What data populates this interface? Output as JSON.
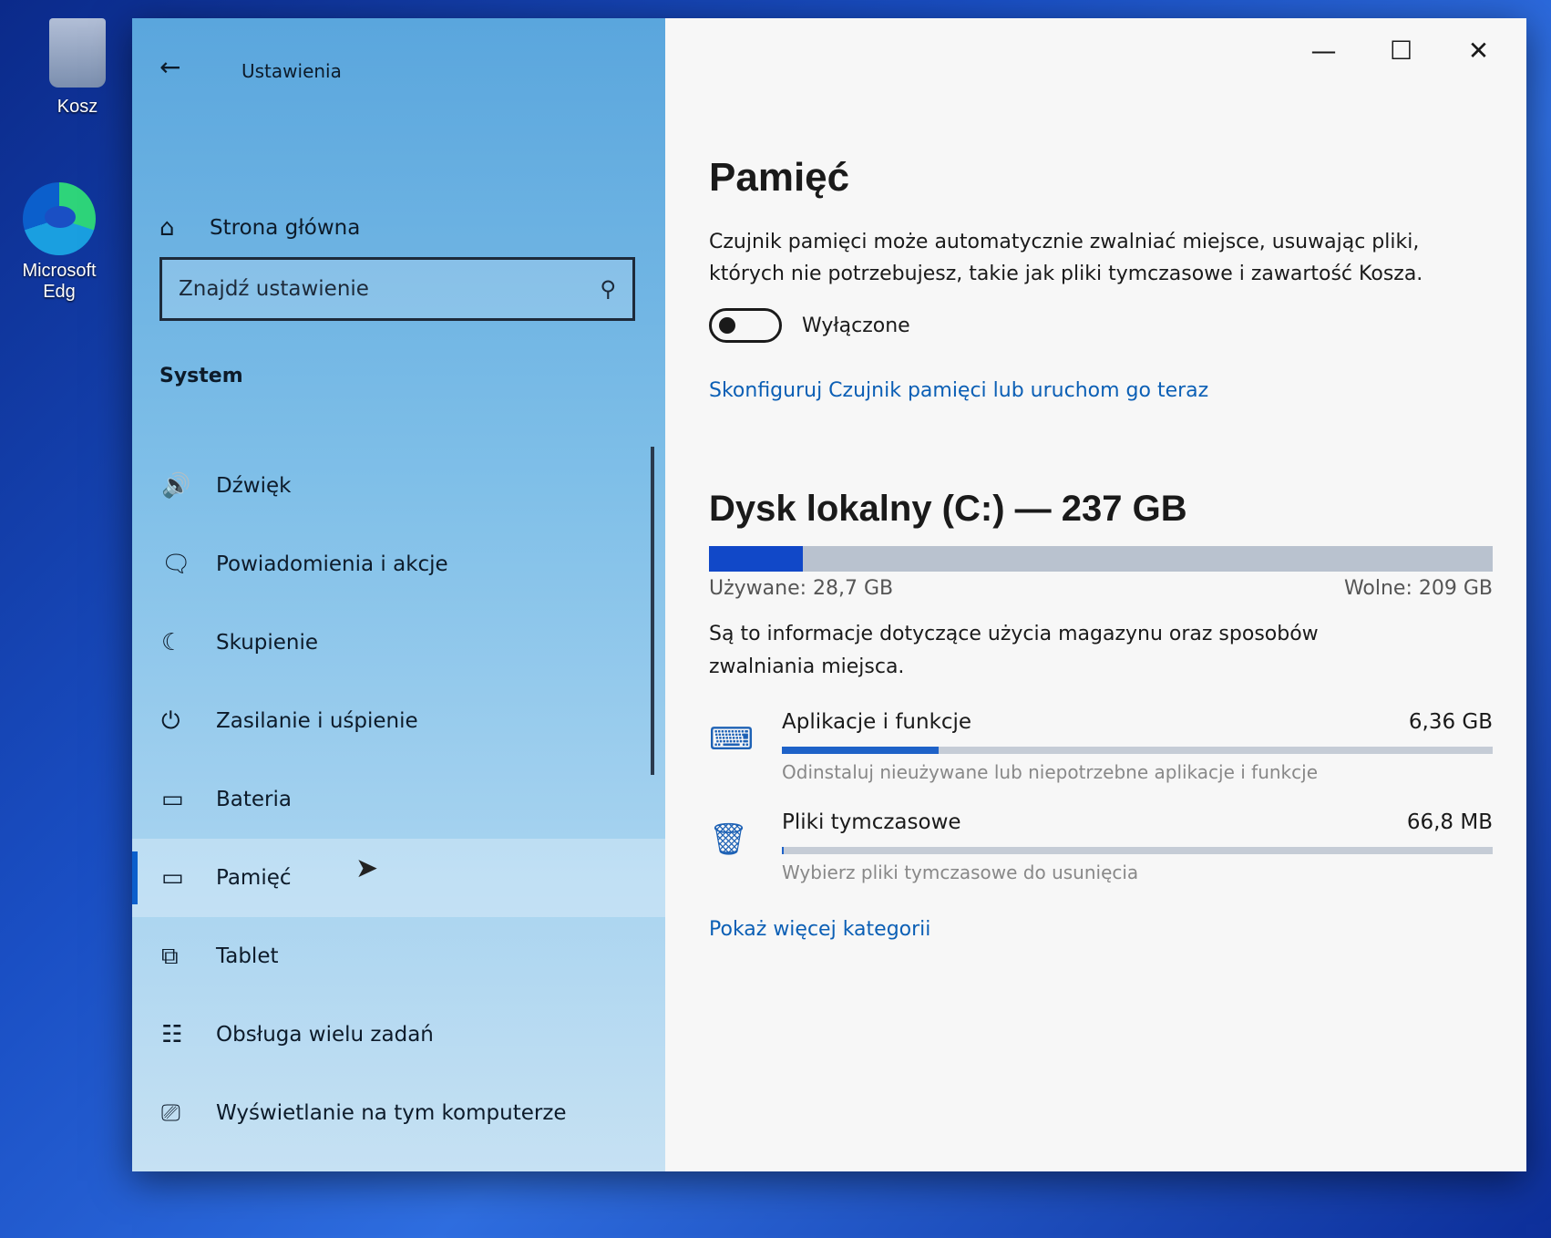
{
  "desktop": {
    "icons": [
      {
        "label": "Kosz"
      },
      {
        "label": "Microsoft Edg"
      }
    ]
  },
  "window": {
    "title": "Ustawienia",
    "controls": {
      "minimize": "—",
      "maximize": "☐",
      "close": "✕"
    }
  },
  "sidebar": {
    "home_label": "Strona główna",
    "search_placeholder": "Znajdź ustawienie",
    "section": "System",
    "items": [
      {
        "label": "Dźwięk",
        "icon": "speaker-icon"
      },
      {
        "label": "Powiadomienia i akcje",
        "icon": "notification-icon"
      },
      {
        "label": "Skupienie",
        "icon": "moon-icon"
      },
      {
        "label": "Zasilanie i uśpienie",
        "icon": "power-icon"
      },
      {
        "label": "Bateria",
        "icon": "battery-icon"
      },
      {
        "label": "Pamięć",
        "icon": "storage-icon",
        "active": true
      },
      {
        "label": "Tablet",
        "icon": "tablet-icon"
      },
      {
        "label": "Obsługa wielu zadań",
        "icon": "multitask-icon"
      },
      {
        "label": "Wyświetlanie na tym komputerze",
        "icon": "project-icon"
      }
    ]
  },
  "main": {
    "title": "Pamięć",
    "description": "Czujnik pamięci może automatycznie zwalniać miejsce, usuwając pliki, których nie potrzebujesz, takie jak pliki tymczasowe i zawartość Kosza.",
    "toggle_label": "Wyłączone",
    "toggle_on": false,
    "configure_link": "Skonfiguruj Czujnik pamięci lub uruchom go teraz",
    "drive": {
      "title": "Dysk lokalny (C:) — 237 GB",
      "used_label": "Używane: 28,7 GB",
      "free_label": "Wolne: 209 GB",
      "used_fraction": 0.12
    },
    "info": "Są to informacje dotyczące użycia magazynu oraz sposobów zwalniania miejsca.",
    "categories": [
      {
        "name": "Aplikacje i funkcje",
        "size": "6,36 GB",
        "subtitle": "Odinstaluj nieużywane lub niepotrzebne aplikacje i funkcje",
        "fraction": 0.22,
        "icon": "keyboard-icon"
      },
      {
        "name": "Pliki tymczasowe",
        "size": "66,8 MB",
        "subtitle": "Wybierz pliki tymczasowe do usunięcia",
        "fraction": 0.003,
        "icon": "trash-icon"
      }
    ],
    "more_link": "Pokaż więcej kategorii"
  }
}
